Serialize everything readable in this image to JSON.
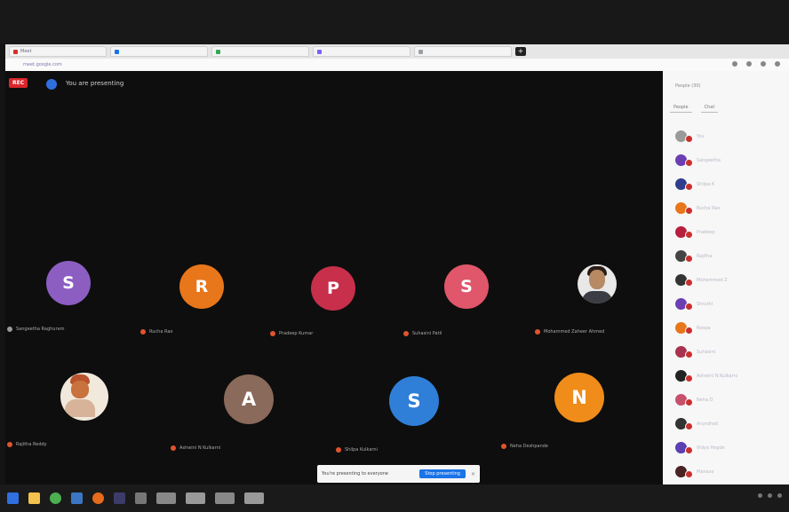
{
  "browser": {
    "tabs": [
      {
        "label": "Meet",
        "color": "#d93025"
      },
      {
        "label": "",
        "color": "#1a73e8"
      },
      {
        "label": "",
        "color": "#34a853"
      },
      {
        "label": "",
        "color": "#7b61ff"
      },
      {
        "label": "",
        "color": "#9aa0a6"
      }
    ],
    "new_tab": "+",
    "address": "meet.google.com"
  },
  "meeting": {
    "rec_label": "REC",
    "presenting_text": "You are presenting",
    "tiles": [
      {
        "initial": "S",
        "color": "#8c5ec2",
        "name": "Sangeetha Raghuram"
      },
      {
        "initial": "R",
        "color": "#e8761b",
        "name": "Rucha Rao"
      },
      {
        "initial": "P",
        "color": "#c72f4b",
        "name": "Pradeep Kumar"
      },
      {
        "initial": "S",
        "color": "#e0566a",
        "name": "Suhasini Patil"
      },
      {
        "initial": "",
        "color": "#ffffff",
        "name": "Mohammed Zaheer Ahmed",
        "photo": true
      },
      {
        "initial": "",
        "color": "#ffffff",
        "name": "Rajitha Reddy",
        "photo": true
      },
      {
        "initial": "A",
        "color": "#8a6a5a",
        "name": "Ashwini N Kulkarni"
      },
      {
        "initial": "S",
        "color": "#2f7fd8",
        "name": "Shilpa Kulkarni"
      },
      {
        "initial": "N",
        "color": "#f08c1a",
        "name": "Neha Deshpande"
      }
    ],
    "toast": {
      "message": "You're presenting to everyone",
      "button": "Stop presenting",
      "close": "×"
    }
  },
  "panel": {
    "title": "People (30)",
    "tabs": [
      "People",
      "Chat"
    ],
    "participants": [
      {
        "name": "You",
        "color": "#9a9a9a"
      },
      {
        "name": "Sangeetha",
        "color": "#6b3fb3"
      },
      {
        "name": "Shilpa K",
        "color": "#2f3d8c"
      },
      {
        "name": "Rucha Rao",
        "color": "#e8761b"
      },
      {
        "name": "Pradeep",
        "color": "#b81f3c"
      },
      {
        "name": "Rajitha",
        "color": "#444444"
      },
      {
        "name": "Mohammed Z",
        "color": "#333333"
      },
      {
        "name": "Shruthi",
        "color": "#6b3fb3"
      },
      {
        "name": "Roopa",
        "color": "#e8761b"
      },
      {
        "name": "Suhasini",
        "color": "#a8324f"
      },
      {
        "name": "Ashwini N Kulkarni",
        "color": "#222222"
      },
      {
        "name": "Neha D",
        "color": "#c7506b"
      },
      {
        "name": "Arundhati",
        "color": "#333333"
      },
      {
        "name": "Vidya Hegde",
        "color": "#5b3fb3"
      },
      {
        "name": "Manasa",
        "color": "#4a2323"
      }
    ]
  },
  "taskbar": {
    "icons": [
      "start-icon",
      "file-explorer-icon",
      "chrome-icon",
      "store-icon",
      "firefox-icon",
      "terminal-icon",
      "settings-icon"
    ]
  }
}
